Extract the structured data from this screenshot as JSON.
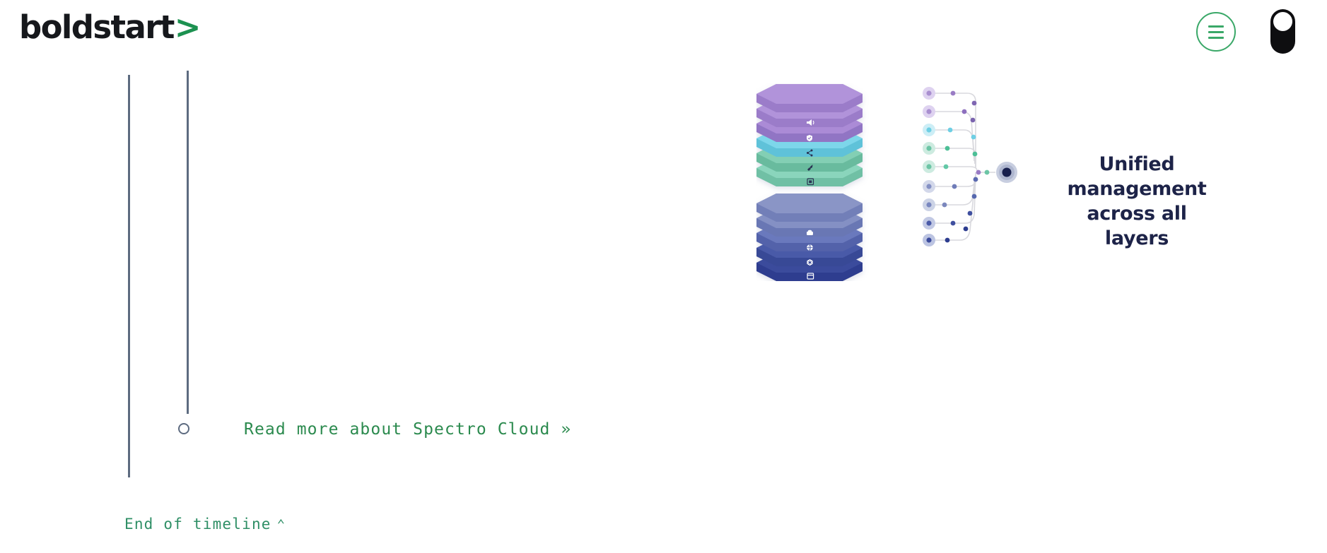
{
  "header": {
    "logo_text": "boldstart",
    "logo_chevron": ">",
    "menu_icon": "hamburger-menu-icon",
    "theme_toggle_icon": "dark-mode-toggle-icon"
  },
  "timeline": {
    "read_more_label": "Read more about Spectro Cloud »",
    "end_label": "End of timeline",
    "end_caret": "⌃",
    "node_icon": "timeline-node-circle-icon"
  },
  "illustration": {
    "caption": "Unified management across all layers",
    "hub_icon": "unified-control-hub-node-icon",
    "top_stack": {
      "layers": [
        {
          "icon": "",
          "top": "#b193da",
          "side": "#9b7cc9"
        },
        {
          "icon": "speaker-icon",
          "top": "#b193da",
          "side": "#9b7cc9"
        },
        {
          "icon": "shield-icon",
          "top": "#ab8bd6",
          "side": "#9175c4"
        },
        {
          "icon": "network-nodes-icon",
          "top": "#7dd6ea",
          "side": "#5fc2d9"
        },
        {
          "icon": "rocket-icon",
          "top": "#83cfb4",
          "side": "#69bb9e"
        },
        {
          "icon": "database-icon",
          "top": "#8ad5bc",
          "side": "#6fc0a5"
        }
      ]
    },
    "bottom_stack": {
      "layers": [
        {
          "icon": "",
          "top": "#8a95c6",
          "side": "#727fb8"
        },
        {
          "icon": "server-icon",
          "top": "#8490c4",
          "side": "#6977b4"
        },
        {
          "icon": "globe-icon",
          "top": "#6b79bd",
          "side": "#5362aa"
        },
        {
          "icon": "kubernetes-icon",
          "top": "#4a5aa8",
          "side": "#394896"
        },
        {
          "icon": "window-icon",
          "top": "#3b4b9c",
          "side": "#2d3d8f"
        }
      ]
    },
    "network_nodes": [
      {
        "color": "#a98fd0",
        "halo": "#ded2f0"
      },
      {
        "color": "#a98fd0",
        "halo": "#ded2f0"
      },
      {
        "color": "#6ecfe4",
        "halo": "#cdeef6"
      },
      {
        "color": "#6cc5a5",
        "halo": "#cdebe0"
      },
      {
        "color": "#6cc5a5",
        "halo": "#cdebe0"
      },
      {
        "color": "#8490c4",
        "halo": "#d3d8ea"
      },
      {
        "color": "#7a88c0",
        "halo": "#ccd3e6"
      },
      {
        "color": "#4a5aa8",
        "halo": "#c2c9e4"
      },
      {
        "color": "#3b4b9c",
        "halo": "#bcc4e2"
      }
    ]
  },
  "colors": {
    "brand_green": "#2b8a4e",
    "accent_green": "#3aa868",
    "timeline_gray": "#5d6b80",
    "caption_navy": "#1d2348",
    "background": "#ffffff"
  }
}
